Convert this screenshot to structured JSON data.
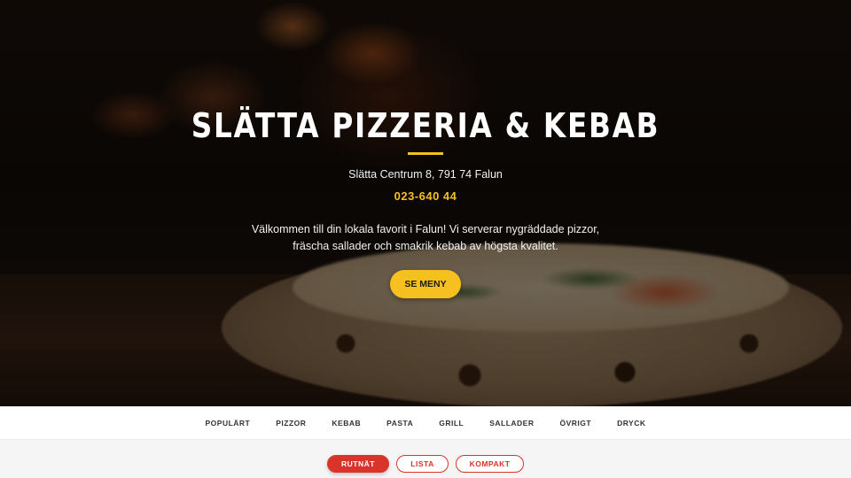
{
  "hero": {
    "title": "SLÄTTA PIZZERIA & KEBAB",
    "address": "Slätta Centrum 8, 791 74 Falun",
    "phone": "023-640 44",
    "welcome": "Välkommen till din lokala favorit i Falun! Vi serverar nygräddade pizzor, fräscha sallader och smakrik kebab av högsta kvalitet.",
    "cta_label": "SE MENY",
    "accent_color": "#f5c020"
  },
  "categories": [
    {
      "label": "POPULÄRT"
    },
    {
      "label": "PIZZOR"
    },
    {
      "label": "KEBAB"
    },
    {
      "label": "PASTA"
    },
    {
      "label": "GRILL"
    },
    {
      "label": "SALLADER"
    },
    {
      "label": "ÖVRIGT"
    },
    {
      "label": "DRYCK"
    }
  ],
  "view_modes": {
    "grid": "RUTNÄT",
    "list": "LISTA",
    "compact": "KOMPAKT",
    "active": "grid",
    "accent_color": "#d8342a"
  }
}
